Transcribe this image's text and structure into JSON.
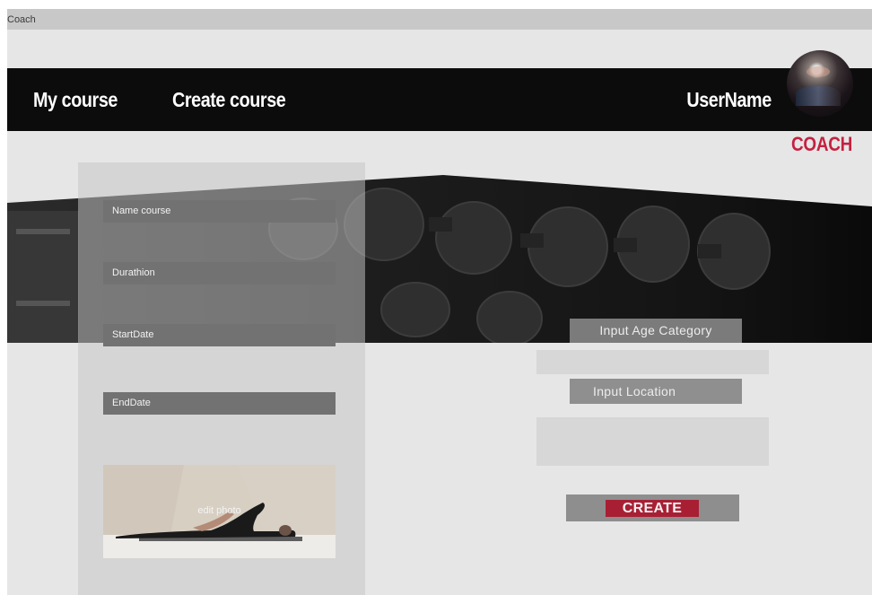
{
  "window": {
    "title": "Coach"
  },
  "nav": {
    "my_course": "My course",
    "create_course": "Create course",
    "username": "UserName"
  },
  "user": {
    "role": "COACH",
    "avatar_icon": "user-avatar-photo"
  },
  "form": {
    "name_course": "Name course",
    "duration": "Durathion",
    "start_date": "StartDate",
    "end_date": "EndDate",
    "photo_label": "edit photo"
  },
  "side": {
    "age_category": "Input Age Category",
    "location": "Input Location",
    "create": "CREATE"
  },
  "colors": {
    "accent": "#c42140",
    "create_button": "#a81f34",
    "navbar": "#0c0c0c"
  }
}
